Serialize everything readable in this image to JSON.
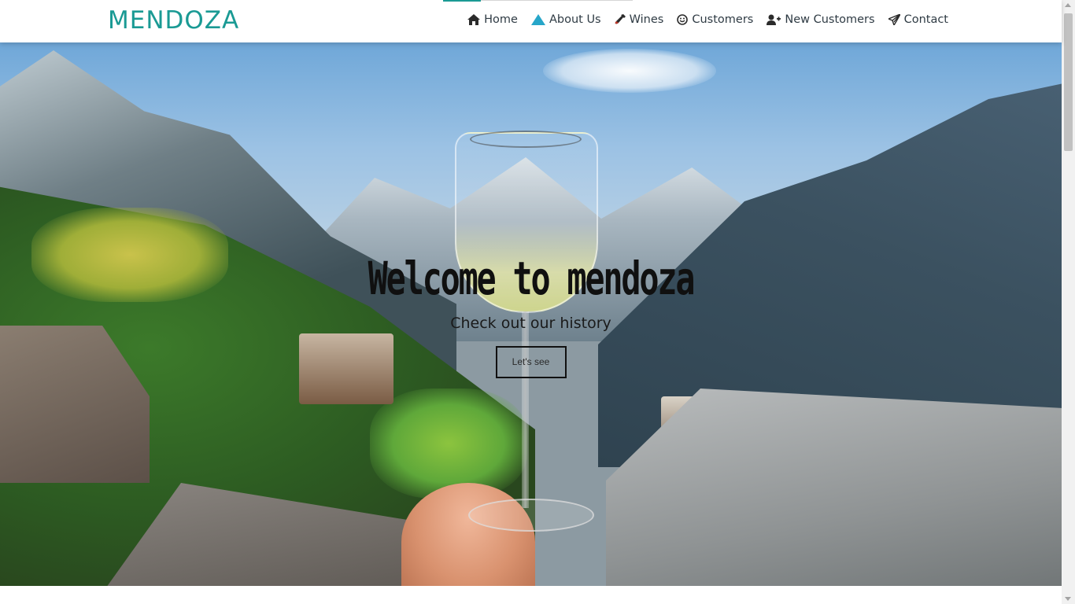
{
  "brand": {
    "name": "MENDOZA",
    "color": "#1a9a94"
  },
  "nav": {
    "items": [
      {
        "label": "Home",
        "icon": "home-icon"
      },
      {
        "label": "About Us",
        "icon": "triangle-icon"
      },
      {
        "label": "Wines",
        "icon": "wine-bottle-icon"
      },
      {
        "label": "Customers",
        "icon": "smile-icon"
      },
      {
        "label": "New Customers",
        "icon": "user-plus-icon"
      },
      {
        "label": "Contact",
        "icon": "paper-plane-icon"
      }
    ],
    "active": "Home"
  },
  "hero": {
    "title": "Welcome to mendoza",
    "subtitle": "Check out our history",
    "button_label": "Let's see"
  },
  "colors": {
    "accent": "#1a9a94",
    "text_dark": "#2f3b44"
  }
}
